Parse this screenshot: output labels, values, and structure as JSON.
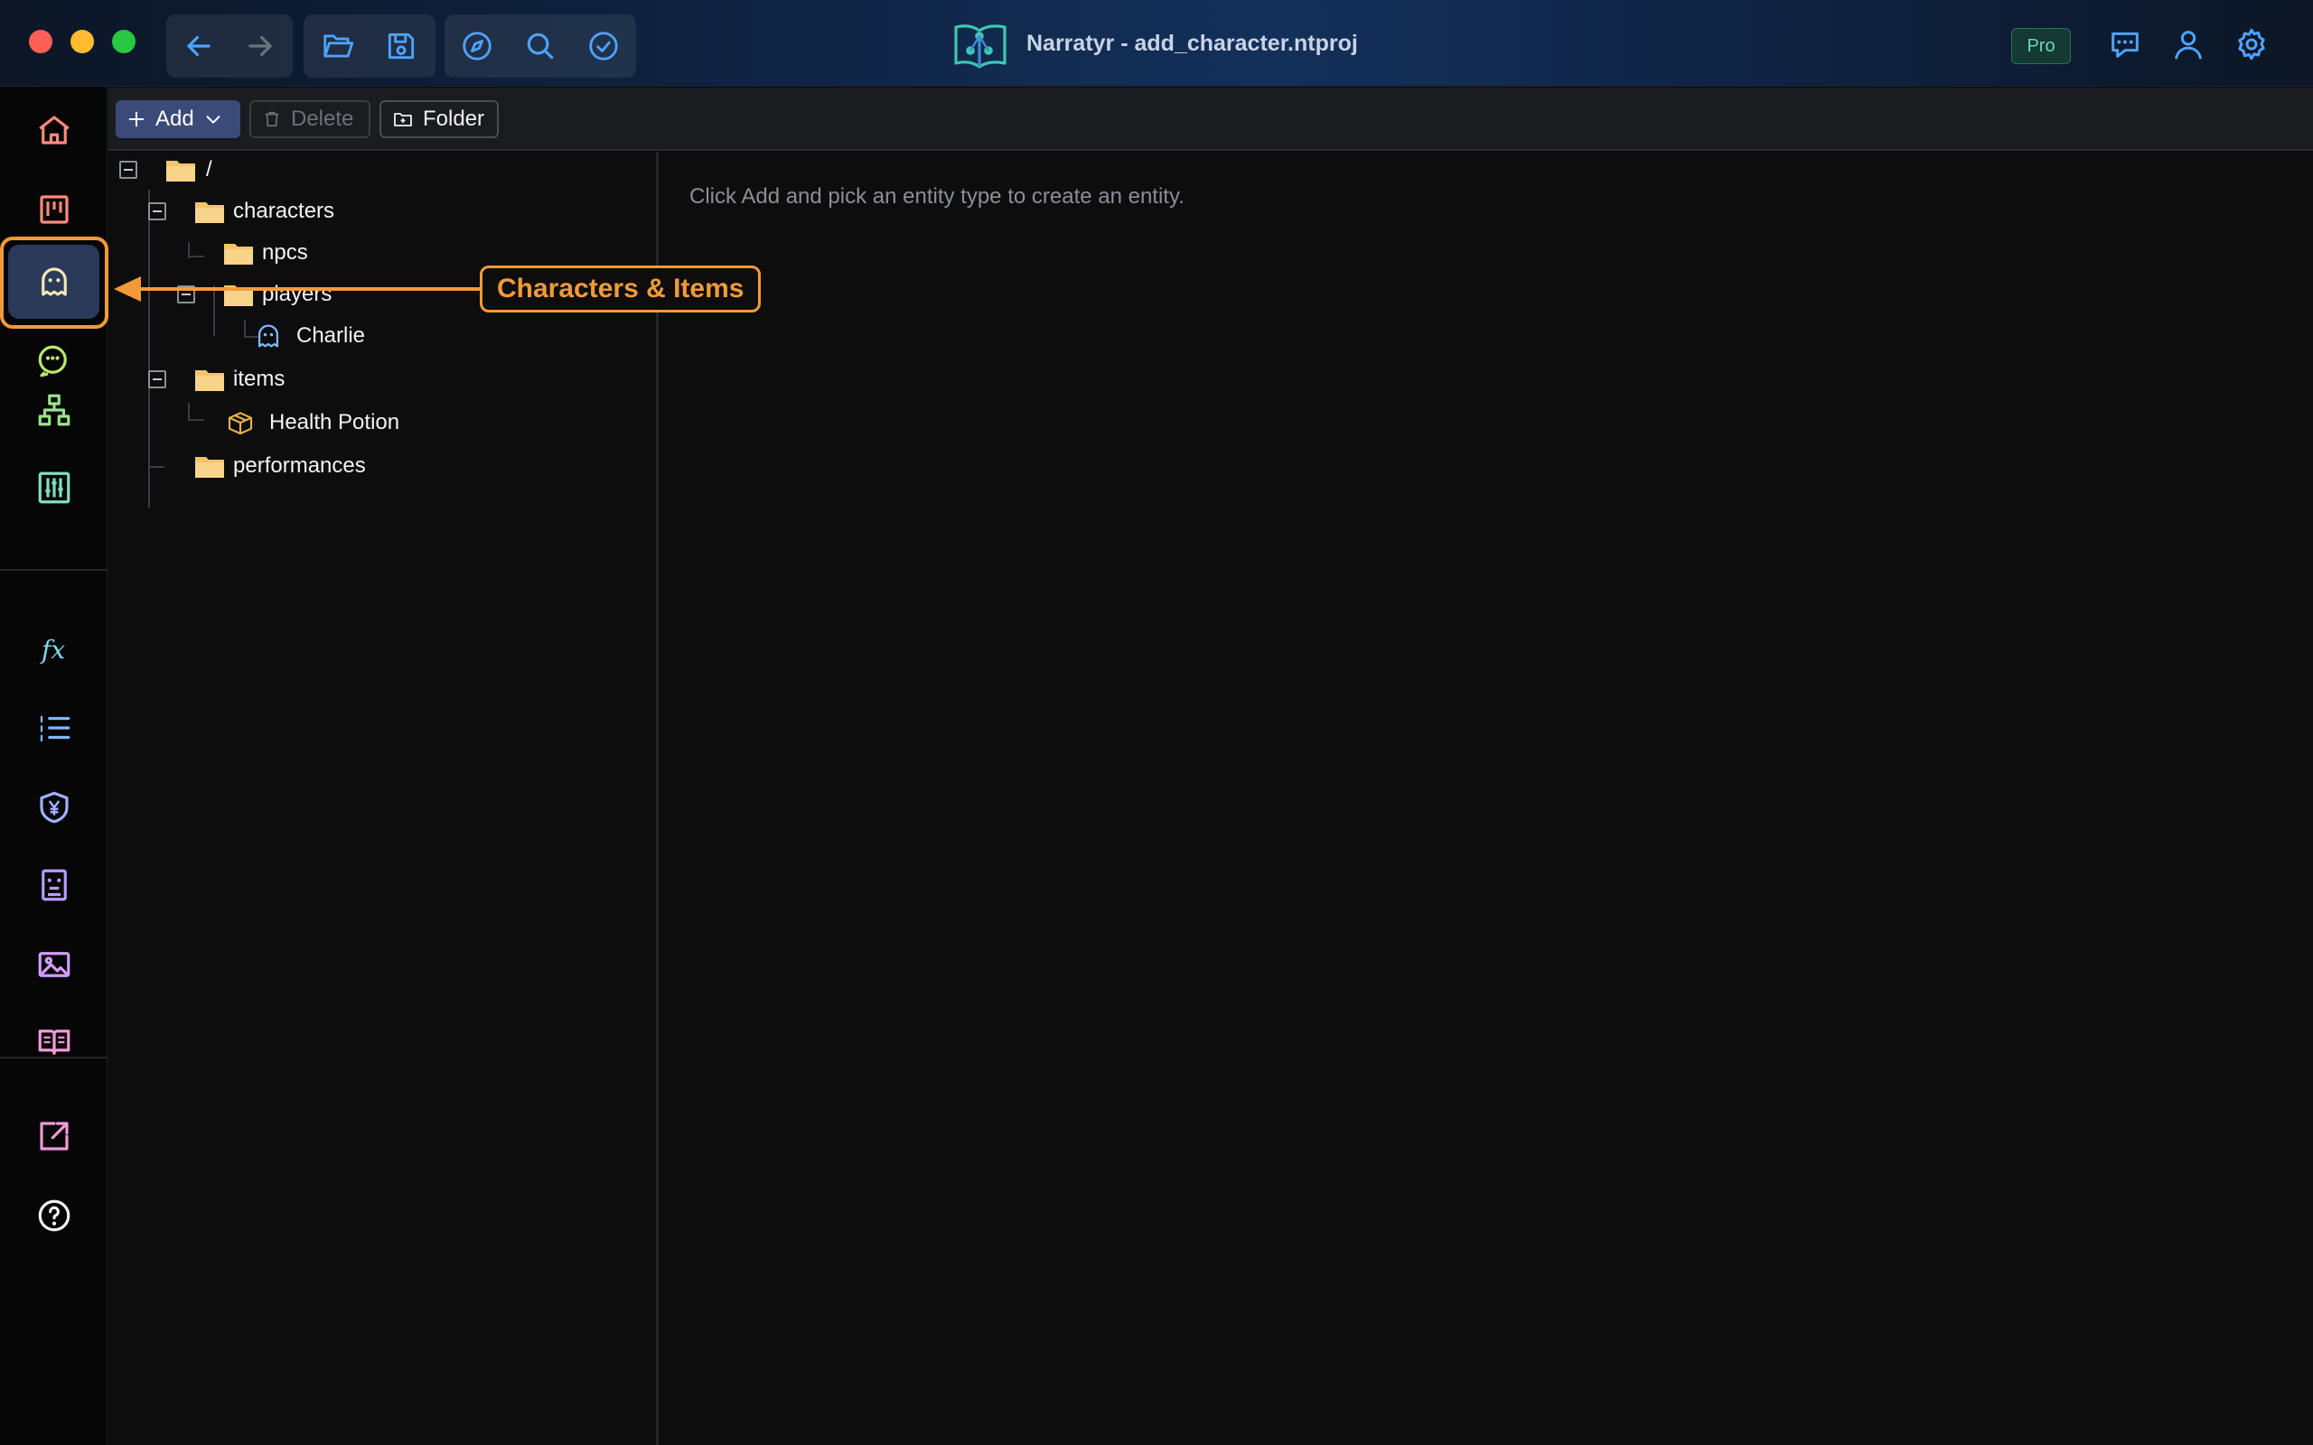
{
  "window": {
    "title": "Narratyr - add_character.ntproj",
    "badge": "Pro"
  },
  "titlebar": {
    "nav_icons": [
      "arrow-left-icon",
      "arrow-right-icon"
    ],
    "file_icons": [
      "folder-open-icon",
      "save-icon"
    ],
    "tool_icons": [
      "compass-icon",
      "search-icon",
      "check-circle-icon"
    ],
    "right_icons": [
      "chat-icon",
      "user-icon",
      "gear-icon"
    ]
  },
  "sidebar": {
    "items": [
      {
        "icon": "home-icon"
      },
      {
        "icon": "kanban-icon"
      },
      {
        "icon": "ghost-icon",
        "active": true
      },
      {
        "icon": "dialogue-icon"
      },
      {
        "icon": "hierarchy-icon"
      },
      {
        "icon": "sliders-icon"
      },
      {
        "icon": "function-icon",
        "text": "fx"
      },
      {
        "icon": "numbered-list-icon"
      },
      {
        "icon": "yen-shield-icon"
      },
      {
        "icon": "id-card-icon"
      },
      {
        "icon": "image-icon"
      },
      {
        "icon": "book-icon"
      },
      {
        "icon": "export-icon"
      },
      {
        "icon": "help-icon"
      }
    ],
    "expand_icon": "chevron-right-icon"
  },
  "toolbar": {
    "add_label": "Add",
    "delete_label": "Delete",
    "folder_label": "Folder"
  },
  "tree": {
    "root": "/",
    "characters": "characters",
    "npcs": "npcs",
    "players": "players",
    "charlie": "Charlie",
    "items": "items",
    "health_potion": "Health Potion",
    "performances": "performances"
  },
  "main": {
    "hint": "Click Add and pick an entity type to create an entity."
  },
  "annotation": {
    "label": "Characters & Items",
    "color": "#f29a38"
  },
  "colors": {
    "folder": "#f5c36a",
    "accent_blue": "#4da3ff",
    "active_bg": "#2a3a58"
  }
}
